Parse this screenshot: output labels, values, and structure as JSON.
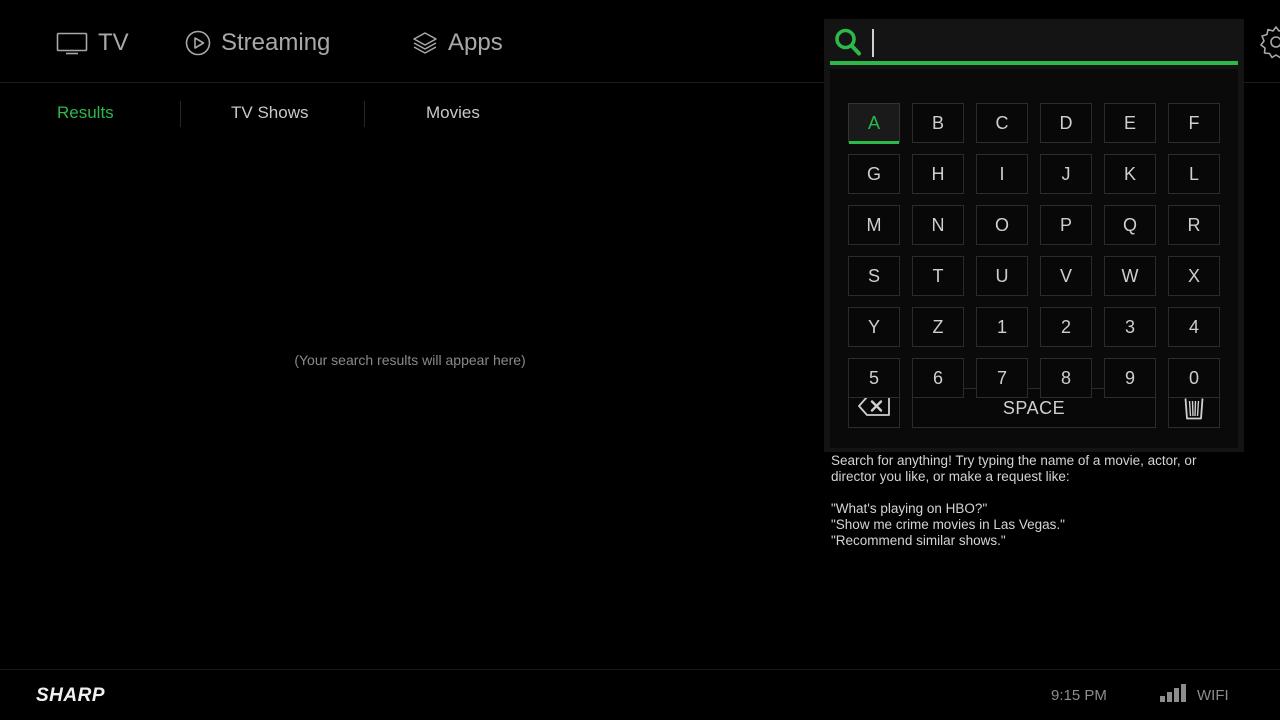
{
  "nav": {
    "tv": "TV",
    "streaming": "Streaming",
    "apps": "Apps"
  },
  "tabs": {
    "results": "Results",
    "tv_shows": "TV Shows",
    "movies": "Movies"
  },
  "results_placeholder": "(Your search results will appear here)",
  "search": {
    "query": "",
    "accent_color": "#2db84a"
  },
  "keyboard": {
    "rows": [
      [
        "A",
        "B",
        "C",
        "D",
        "E",
        "F"
      ],
      [
        "G",
        "H",
        "I",
        "J",
        "K",
        "L"
      ],
      [
        "M",
        "N",
        "O",
        "P",
        "Q",
        "R"
      ],
      [
        "S",
        "T",
        "U",
        "V",
        "W",
        "X"
      ],
      [
        "Y",
        "Z",
        "1",
        "2",
        "3",
        "4"
      ],
      [
        "5",
        "6",
        "7",
        "8",
        "9",
        "0"
      ]
    ],
    "selected_key": "A",
    "space_label": "SPACE",
    "backspace_icon": "backspace-icon",
    "clear_icon": "trash-icon"
  },
  "hint": {
    "line1": "Search for anything! Try typing the name of a movie, actor, or",
    "line2": "director you like, or make a request like:",
    "example1": "\"What's playing on HBO?\"",
    "example2": "\"Show me crime movies in Las Vegas.\"",
    "example3": "\"Recommend similar shows.\""
  },
  "footer": {
    "brand": "SHARP",
    "time": "9:15 PM",
    "wifi_label": "WIFI",
    "wifi_bars": 4
  }
}
